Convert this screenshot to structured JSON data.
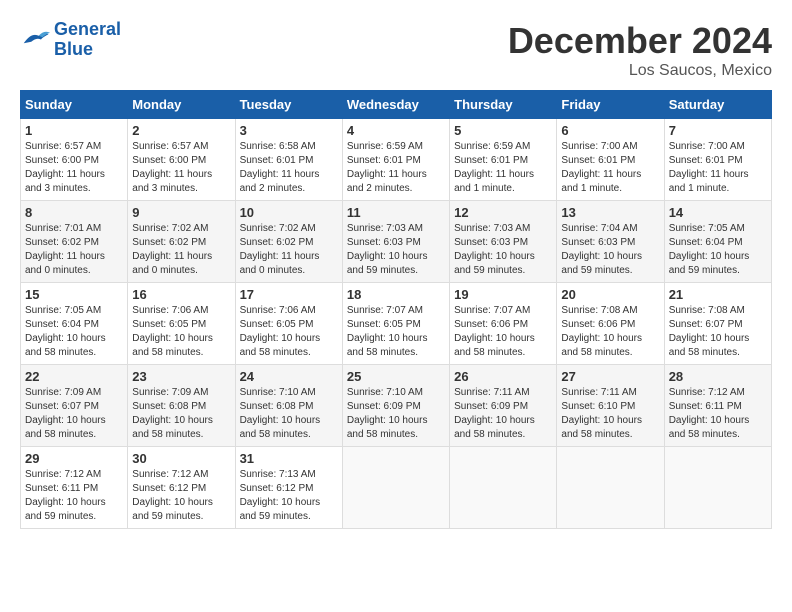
{
  "header": {
    "logo_line1": "General",
    "logo_line2": "Blue",
    "month_title": "December 2024",
    "location": "Los Saucos, Mexico"
  },
  "weekdays": [
    "Sunday",
    "Monday",
    "Tuesday",
    "Wednesday",
    "Thursday",
    "Friday",
    "Saturday"
  ],
  "weeks": [
    [
      {
        "day": "1",
        "info": "Sunrise: 6:57 AM\nSunset: 6:00 PM\nDaylight: 11 hours\nand 3 minutes."
      },
      {
        "day": "2",
        "info": "Sunrise: 6:57 AM\nSunset: 6:00 PM\nDaylight: 11 hours\nand 3 minutes."
      },
      {
        "day": "3",
        "info": "Sunrise: 6:58 AM\nSunset: 6:01 PM\nDaylight: 11 hours\nand 2 minutes."
      },
      {
        "day": "4",
        "info": "Sunrise: 6:59 AM\nSunset: 6:01 PM\nDaylight: 11 hours\nand 2 minutes."
      },
      {
        "day": "5",
        "info": "Sunrise: 6:59 AM\nSunset: 6:01 PM\nDaylight: 11 hours\nand 1 minute."
      },
      {
        "day": "6",
        "info": "Sunrise: 7:00 AM\nSunset: 6:01 PM\nDaylight: 11 hours\nand 1 minute."
      },
      {
        "day": "7",
        "info": "Sunrise: 7:00 AM\nSunset: 6:01 PM\nDaylight: 11 hours\nand 1 minute."
      }
    ],
    [
      {
        "day": "8",
        "info": "Sunrise: 7:01 AM\nSunset: 6:02 PM\nDaylight: 11 hours\nand 0 minutes."
      },
      {
        "day": "9",
        "info": "Sunrise: 7:02 AM\nSunset: 6:02 PM\nDaylight: 11 hours\nand 0 minutes."
      },
      {
        "day": "10",
        "info": "Sunrise: 7:02 AM\nSunset: 6:02 PM\nDaylight: 11 hours\nand 0 minutes."
      },
      {
        "day": "11",
        "info": "Sunrise: 7:03 AM\nSunset: 6:03 PM\nDaylight: 10 hours\nand 59 minutes."
      },
      {
        "day": "12",
        "info": "Sunrise: 7:03 AM\nSunset: 6:03 PM\nDaylight: 10 hours\nand 59 minutes."
      },
      {
        "day": "13",
        "info": "Sunrise: 7:04 AM\nSunset: 6:03 PM\nDaylight: 10 hours\nand 59 minutes."
      },
      {
        "day": "14",
        "info": "Sunrise: 7:05 AM\nSunset: 6:04 PM\nDaylight: 10 hours\nand 59 minutes."
      }
    ],
    [
      {
        "day": "15",
        "info": "Sunrise: 7:05 AM\nSunset: 6:04 PM\nDaylight: 10 hours\nand 58 minutes."
      },
      {
        "day": "16",
        "info": "Sunrise: 7:06 AM\nSunset: 6:05 PM\nDaylight: 10 hours\nand 58 minutes."
      },
      {
        "day": "17",
        "info": "Sunrise: 7:06 AM\nSunset: 6:05 PM\nDaylight: 10 hours\nand 58 minutes."
      },
      {
        "day": "18",
        "info": "Sunrise: 7:07 AM\nSunset: 6:05 PM\nDaylight: 10 hours\nand 58 minutes."
      },
      {
        "day": "19",
        "info": "Sunrise: 7:07 AM\nSunset: 6:06 PM\nDaylight: 10 hours\nand 58 minutes."
      },
      {
        "day": "20",
        "info": "Sunrise: 7:08 AM\nSunset: 6:06 PM\nDaylight: 10 hours\nand 58 minutes."
      },
      {
        "day": "21",
        "info": "Sunrise: 7:08 AM\nSunset: 6:07 PM\nDaylight: 10 hours\nand 58 minutes."
      }
    ],
    [
      {
        "day": "22",
        "info": "Sunrise: 7:09 AM\nSunset: 6:07 PM\nDaylight: 10 hours\nand 58 minutes."
      },
      {
        "day": "23",
        "info": "Sunrise: 7:09 AM\nSunset: 6:08 PM\nDaylight: 10 hours\nand 58 minutes."
      },
      {
        "day": "24",
        "info": "Sunrise: 7:10 AM\nSunset: 6:08 PM\nDaylight: 10 hours\nand 58 minutes."
      },
      {
        "day": "25",
        "info": "Sunrise: 7:10 AM\nSunset: 6:09 PM\nDaylight: 10 hours\nand 58 minutes."
      },
      {
        "day": "26",
        "info": "Sunrise: 7:11 AM\nSunset: 6:09 PM\nDaylight: 10 hours\nand 58 minutes."
      },
      {
        "day": "27",
        "info": "Sunrise: 7:11 AM\nSunset: 6:10 PM\nDaylight: 10 hours\nand 58 minutes."
      },
      {
        "day": "28",
        "info": "Sunrise: 7:12 AM\nSunset: 6:11 PM\nDaylight: 10 hours\nand 58 minutes."
      }
    ],
    [
      {
        "day": "29",
        "info": "Sunrise: 7:12 AM\nSunset: 6:11 PM\nDaylight: 10 hours\nand 59 minutes."
      },
      {
        "day": "30",
        "info": "Sunrise: 7:12 AM\nSunset: 6:12 PM\nDaylight: 10 hours\nand 59 minutes."
      },
      {
        "day": "31",
        "info": "Sunrise: 7:13 AM\nSunset: 6:12 PM\nDaylight: 10 hours\nand 59 minutes."
      },
      {
        "day": "",
        "info": ""
      },
      {
        "day": "",
        "info": ""
      },
      {
        "day": "",
        "info": ""
      },
      {
        "day": "",
        "info": ""
      }
    ]
  ]
}
